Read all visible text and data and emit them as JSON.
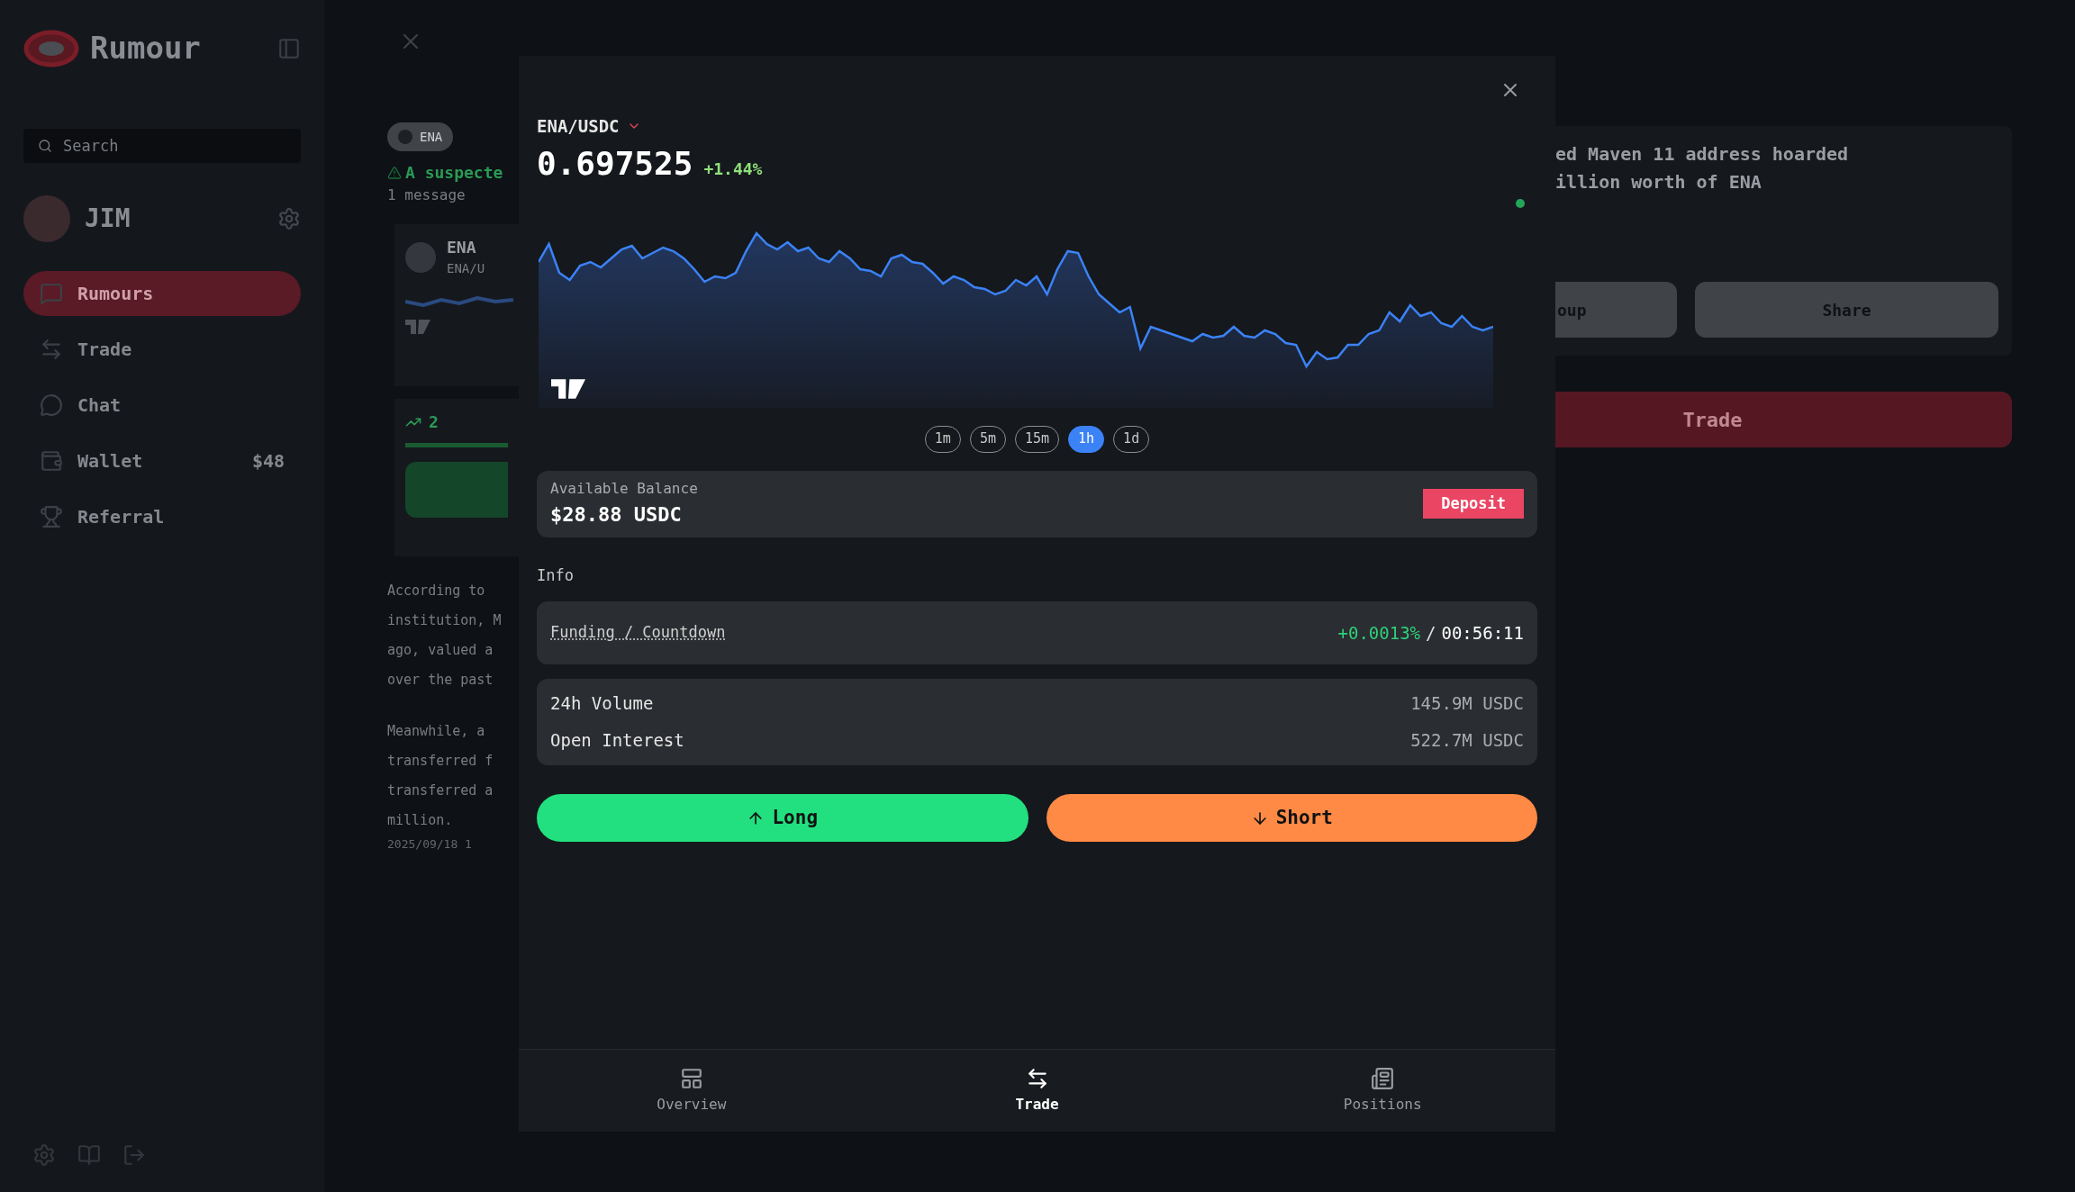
{
  "sidebar": {
    "brand": "Rumour",
    "search": {
      "placeholder": "Search"
    },
    "user": {
      "name": "JIM"
    },
    "nav": [
      {
        "label": "Rumours",
        "selected": true
      },
      {
        "label": "Trade",
        "selected": false
      },
      {
        "label": "Chat",
        "selected": false
      },
      {
        "label": "Wallet",
        "selected": false,
        "badge": "$48"
      },
      {
        "label": "Referral",
        "selected": false
      }
    ]
  },
  "background": {
    "tag": "ENA",
    "headline": "A suspecte",
    "message_count": "1 message",
    "card": {
      "symbol": "ENA",
      "pair": "ENA/U"
    },
    "stat": "2",
    "paragraphs": [
      [
        "According to",
        "institution, M",
        "ago, valued a",
        "over the past"
      ],
      [
        "Meanwhile, a",
        "transferred f",
        "transferred a",
        "million."
      ]
    ],
    "timestamp": "2025/09/18 1",
    "right": {
      "title_lines": [
        "ed Maven 11 address hoarded",
        "illion worth of ENA"
      ],
      "buttons": [
        "oup",
        "Share"
      ],
      "trade_button": "Trade"
    }
  },
  "modal": {
    "pair": "ENA/USDC",
    "price": "0.697525",
    "change": "+1.44%",
    "timeframes": [
      {
        "label": "1m",
        "selected": false
      },
      {
        "label": "5m",
        "selected": false
      },
      {
        "label": "15m",
        "selected": false
      },
      {
        "label": "1h",
        "selected": true
      },
      {
        "label": "1d",
        "selected": false
      }
    ],
    "balance": {
      "label": "Available Balance",
      "value": "$28.88 USDC",
      "button": "Deposit"
    },
    "info_label": "Info",
    "funding": {
      "label": "Funding / Countdown",
      "rate": "+0.0013%",
      "separator": "/",
      "countdown": "00:56:11"
    },
    "stats": [
      {
        "label": "24h Volume",
        "value": "145.9M USDC"
      },
      {
        "label": "Open Interest",
        "value": "522.7M USDC"
      }
    ],
    "actions": [
      {
        "kind": "long",
        "label": "Long"
      },
      {
        "kind": "short",
        "label": "Short"
      }
    ],
    "tabs": [
      {
        "kind": "overview",
        "label": "Overview",
        "selected": false
      },
      {
        "kind": "trade",
        "label": "Trade",
        "selected": true
      },
      {
        "kind": "positions",
        "label": "Positions",
        "selected": false
      }
    ]
  }
}
